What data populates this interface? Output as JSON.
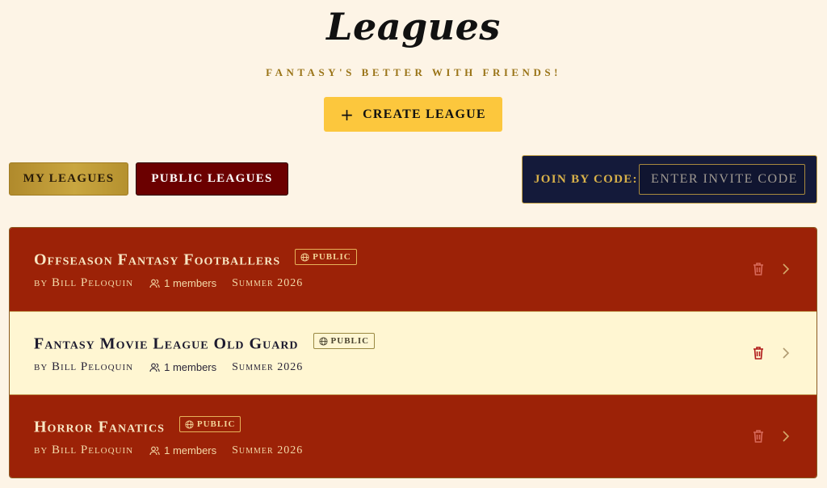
{
  "header": {
    "title": "Leagues",
    "subtitle": "Fantasy's better with friends!",
    "create_label": "Create League"
  },
  "tabs": [
    {
      "label": "My Leagues",
      "active": false
    },
    {
      "label": "Public Leagues",
      "active": true
    }
  ],
  "join": {
    "label": "Join by code:",
    "placeholder": "Enter invite code",
    "value": ""
  },
  "leagues": [
    {
      "name": "Offseason Fantasy Footballers",
      "badge": "Public",
      "owner": "by Bill Peloquin",
      "members": "1 members",
      "season": "Summer 2026",
      "style": "dark"
    },
    {
      "name": "Fantasy Movie League Old Guard",
      "badge": "Public",
      "owner": "by Bill Peloquin",
      "members": "1 members",
      "season": "Summer 2026",
      "style": "light"
    },
    {
      "name": "Horror Fanatics",
      "badge": "Public",
      "owner": "by Bill Peloquin",
      "members": "1 members",
      "season": "Summer 2026",
      "style": "dark"
    }
  ],
  "icons": {
    "badge": "globe-icon",
    "members": "users-icon",
    "delete": "trash-icon",
    "open": "chevron-right-icon",
    "create": "plus-icon"
  },
  "colors": {
    "background": "#fdf4e6",
    "accent_gold": "#fcc73d",
    "row_dark": "#9c2207",
    "row_light": "#fff6d2",
    "join_panel": "#141a3a",
    "public_tab": "#6b0000"
  }
}
